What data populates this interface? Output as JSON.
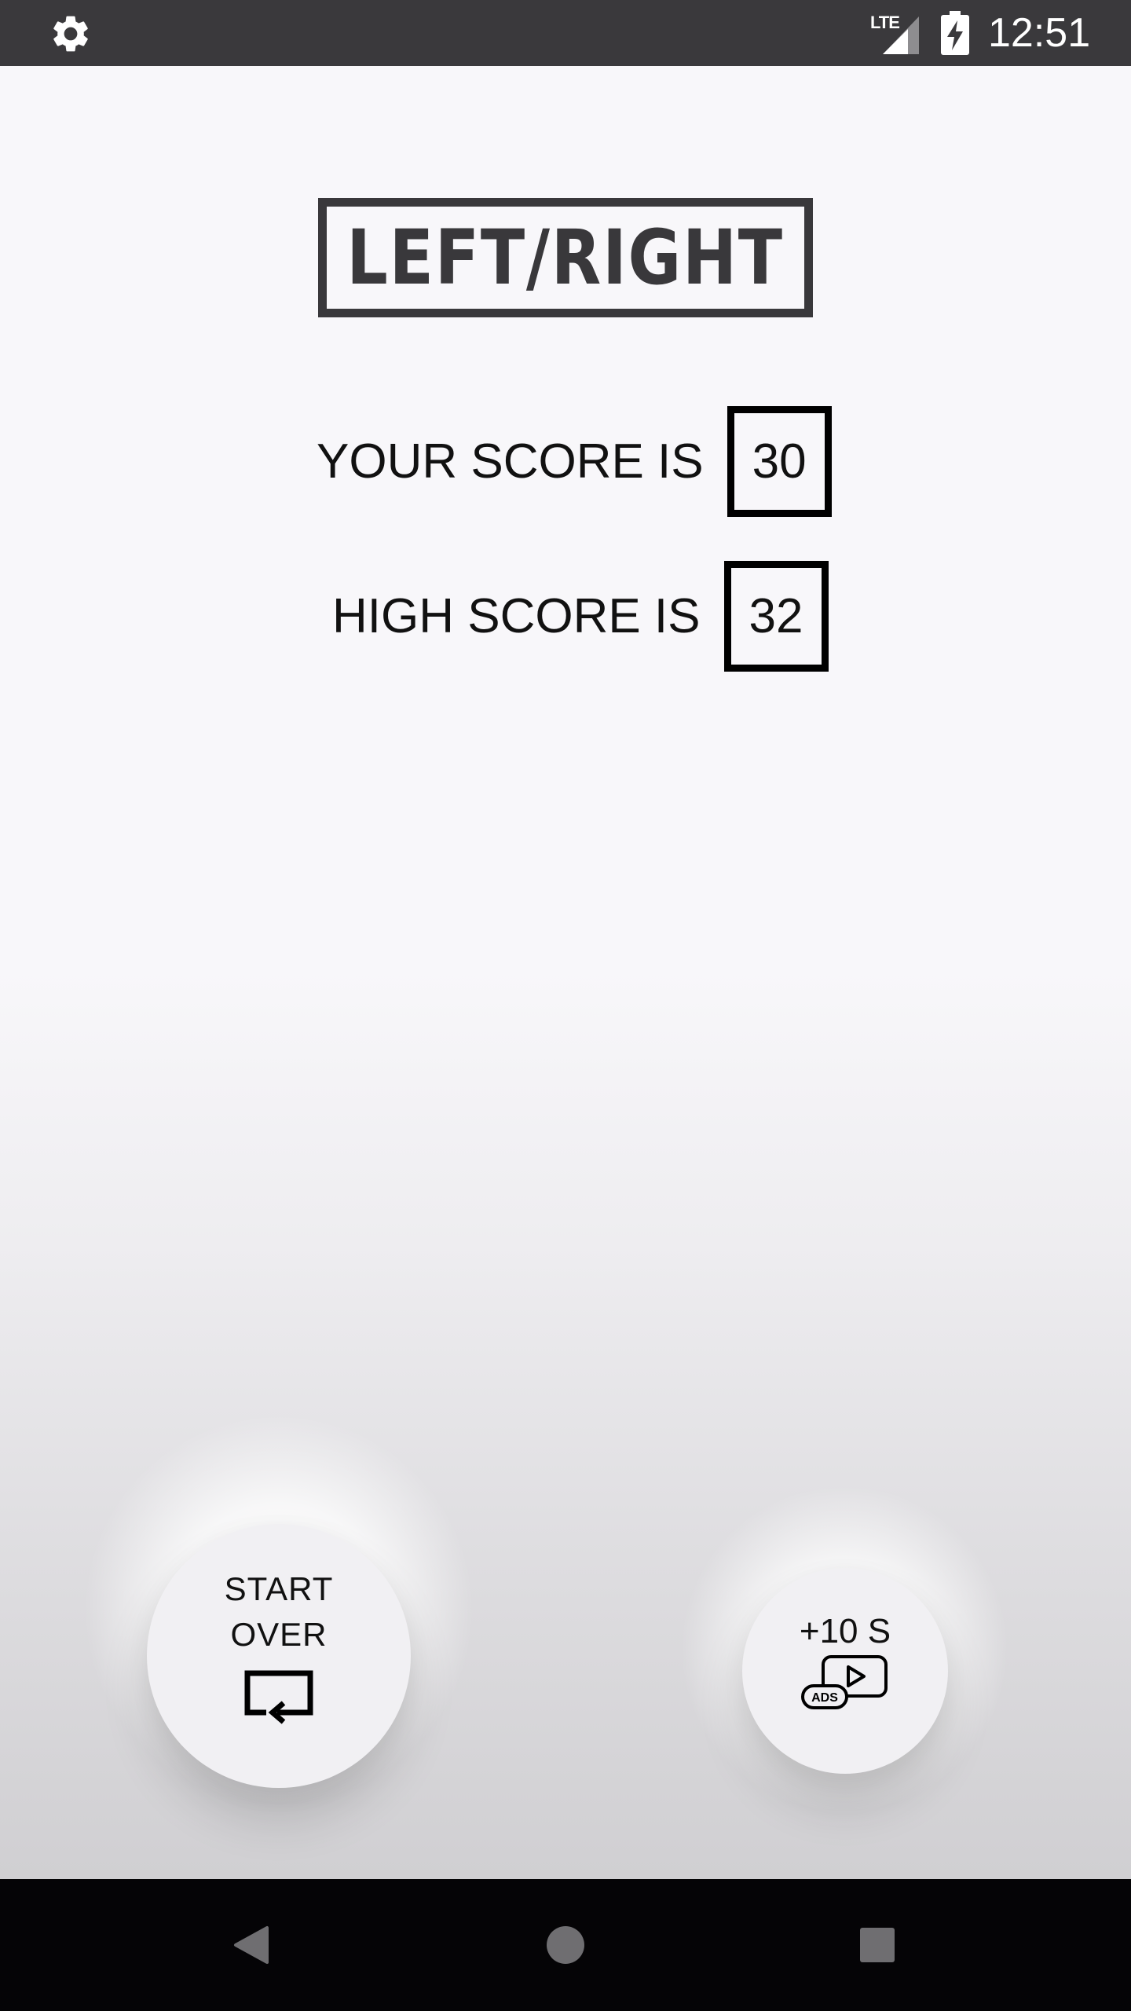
{
  "status_bar": {
    "time": "12:51",
    "network_label": "LTE",
    "icons": [
      "gear-icon",
      "lte-signal-icon",
      "battery-charging-icon"
    ]
  },
  "logo": {
    "text": "LEFT/RIGHT"
  },
  "scores": {
    "your_score_label": "YOUR SCORE IS",
    "your_score_value": "30",
    "high_score_label": "HIGH SCORE IS",
    "high_score_value": "32"
  },
  "buttons": {
    "start_over_line1": "START",
    "start_over_line2": "OVER",
    "start_over_icon": "replay-icon",
    "bonus_label": "+10 S",
    "bonus_icon": "watch-ad-icon",
    "bonus_icon_badge": "ADS"
  },
  "nav_bar": {
    "icons": [
      "back-icon",
      "home-icon",
      "recents-icon"
    ]
  },
  "colors": {
    "status_bar": "#3a393c",
    "nav_bar": "#050406",
    "logo": "#39383b",
    "background_top": "#f8f7fa",
    "background_bottom": "#d0cfd2"
  }
}
